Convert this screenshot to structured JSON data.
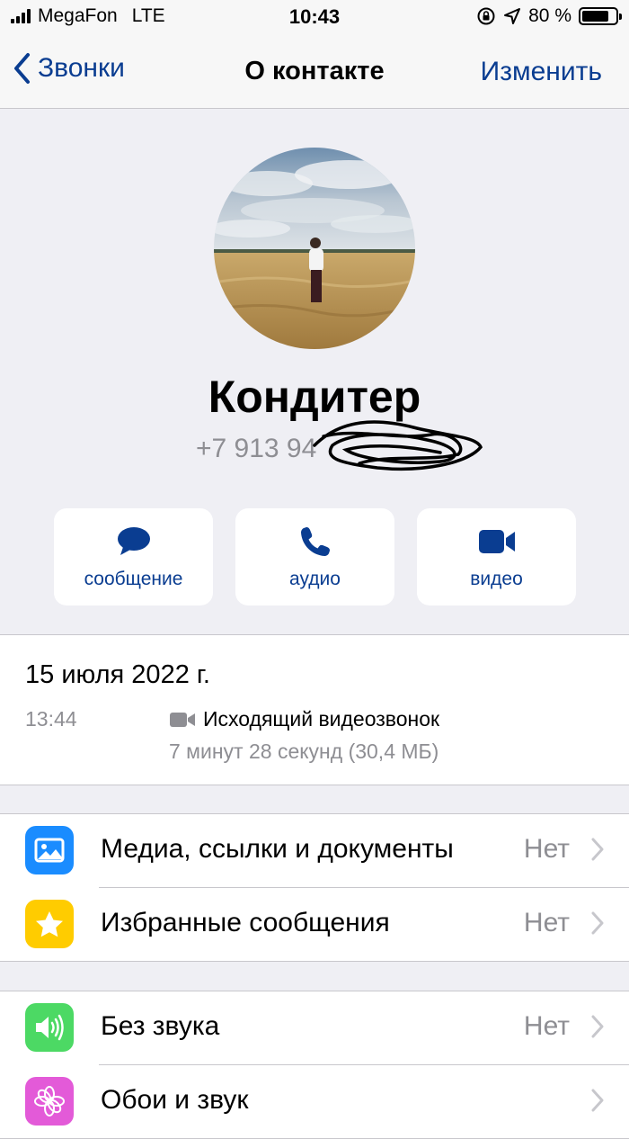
{
  "status_bar": {
    "carrier": "MegaFon",
    "network": "LTE",
    "time": "10:43",
    "battery": "80 %",
    "battery_level": 0.8
  },
  "nav": {
    "back_label": "Звонки",
    "title": "О контакте",
    "edit_label": "Изменить"
  },
  "contact": {
    "name": "Кондитер",
    "phone_visible": "+7 913 94"
  },
  "actions": [
    {
      "label": "сообщение",
      "icon": "chat-bubble-icon"
    },
    {
      "label": "аудио",
      "icon": "phone-icon"
    },
    {
      "label": "видео",
      "icon": "video-camera-icon"
    }
  ],
  "call": {
    "date": "15 июля 2022 г.",
    "time": "13:44",
    "type": "Исходящий видеозвонок",
    "duration": "7 минут 28 секунд (30,4 МБ)"
  },
  "group1": [
    {
      "label": "Медиа, ссылки и документы",
      "value": "Нет",
      "icon": "photo-icon",
      "color": "#1a8cff"
    },
    {
      "label": "Избранные сообщения",
      "value": "Нет",
      "icon": "star-icon",
      "color": "#ffcc00"
    }
  ],
  "group2": [
    {
      "label": "Без звука",
      "value": "Нет",
      "icon": "speaker-icon",
      "color": "#4cd964"
    },
    {
      "label": "Обои и звук",
      "value": "",
      "icon": "flower-icon",
      "color": "#e35ad8"
    }
  ],
  "colors": {
    "accent": "#0a3d91",
    "background": "#efeff4",
    "secondary_text": "#8e8e93"
  }
}
